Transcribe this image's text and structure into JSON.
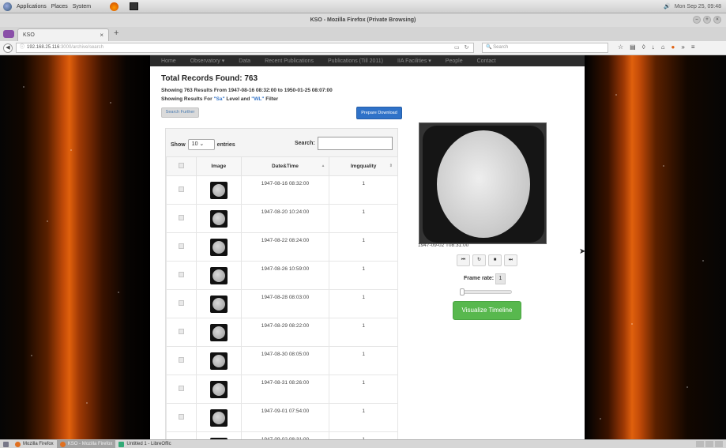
{
  "system_panel": {
    "menu_items": [
      "Applications",
      "Places",
      "System"
    ],
    "clock": "Mon Sep 25, 09:48"
  },
  "window": {
    "title": "KSO - Mozilla Firefox (Private Browsing)"
  },
  "browser": {
    "tab_title": "KSO",
    "url_host": "192.168.25.116",
    "url_path": ":3000/archive/search",
    "search_placeholder": "Search"
  },
  "site_nav": {
    "items": [
      "Home",
      "Observatory ▾",
      "Data",
      "Recent Publications",
      "Publications (Till 2011)",
      "IIA Facilities ▾",
      "People",
      "Contact"
    ]
  },
  "results": {
    "total": "Total Records Found: 763",
    "showing": "Showing 763 Results From 1947-08-16 08:32:00 to 1950-01-25 08:07:00",
    "filter_prefix": "Showing Results For ",
    "filter_level": "\"Sa\"",
    "filter_mid": " Level and ",
    "filter_type": "\"WL\"",
    "filter_suffix": " Filter",
    "search_further": "Search Further",
    "prepare_download": "Prepare Download"
  },
  "table": {
    "show_label": "Show",
    "entries_value": "10",
    "entries_label": "entries",
    "search_label": "Search:",
    "headers": [
      "",
      "Image",
      "Date&Time",
      "Imgquality"
    ],
    "rows": [
      {
        "datetime": "1947-08-16 08:32:00",
        "quality": "1"
      },
      {
        "datetime": "1947-08-20 10:24:00",
        "quality": "1"
      },
      {
        "datetime": "1947-08-22 08:24:00",
        "quality": "1"
      },
      {
        "datetime": "1947-08-26 10:59:00",
        "quality": "1"
      },
      {
        "datetime": "1947-08-28 08:03:00",
        "quality": "1"
      },
      {
        "datetime": "1947-08-29 08:22:00",
        "quality": "1"
      },
      {
        "datetime": "1947-08-30 08:05:00",
        "quality": "1"
      },
      {
        "datetime": "1947-08-31 08:26:00",
        "quality": "1"
      },
      {
        "datetime": "1947-09-01 07:54:00",
        "quality": "1"
      },
      {
        "datetime": "1947-09-02 08:31:00",
        "quality": "1"
      }
    ]
  },
  "viewer": {
    "timestamp": "1947-09-02 T08:31:00",
    "controls": [
      "⏮",
      "↻",
      "■",
      "⏭"
    ],
    "frame_rate_label": "Frame rate:",
    "frame_rate_value": "1",
    "visualize_button": "Visualize Timeline"
  },
  "taskbar": {
    "items": [
      "Mozilla Firefox",
      "KSO - Mozilla Firefox",
      "Untitled 1 - LibreOffic"
    ]
  }
}
